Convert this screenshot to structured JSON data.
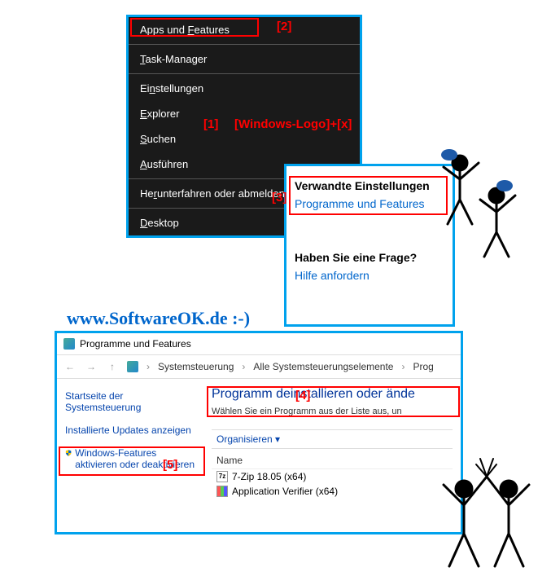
{
  "context_menu": {
    "items": [
      {
        "label": "Apps und Features",
        "accel": "F"
      },
      {
        "label": "Task-Manager",
        "accel": "T"
      },
      {
        "label": "Einstellungen",
        "accel": "n"
      },
      {
        "label": "Explorer",
        "accel": "E"
      },
      {
        "label": "Suchen",
        "accel": "S"
      },
      {
        "label": "Ausführen",
        "accel": "A"
      },
      {
        "label": "Herunterfahren oder abmelden",
        "accel": "r",
        "arrow": true
      },
      {
        "label": "Desktop",
        "accel": "D"
      }
    ]
  },
  "annotations": {
    "n1": "[1]",
    "n1_hint": "[Windows-Logo]+[x]",
    "n2": "[2]",
    "n3": "[3]",
    "n4": "[4]",
    "n5": "[5]"
  },
  "settings": {
    "heading1": "Verwandte Einstellungen",
    "link1": "Programme und Features",
    "heading2": "Haben Sie eine Frage?",
    "link2": "Hilfe anfordern"
  },
  "watermark": "www.SoftwareOK.de :-)",
  "programs_window": {
    "title": "Programme und Features",
    "breadcrumb": {
      "p1": "Systemsteuerung",
      "p2": "Alle Systemsteuerungselemente",
      "p3": "Prog"
    },
    "sidebar": {
      "link1": "Startseite der Systemsteuerung",
      "link2": "Installierte Updates anzeigen",
      "link3": "Windows-Features aktivieren oder deaktivieren"
    },
    "main": {
      "heading": "Programm deinstallieren oder ände",
      "sub": "Wählen Sie ein Programm aus der Liste aus, un",
      "organize": "Organisieren ▾",
      "col_name": "Name",
      "rows": [
        "7-Zip 18.05 (x64)",
        "Application Verifier (x64)"
      ]
    }
  }
}
